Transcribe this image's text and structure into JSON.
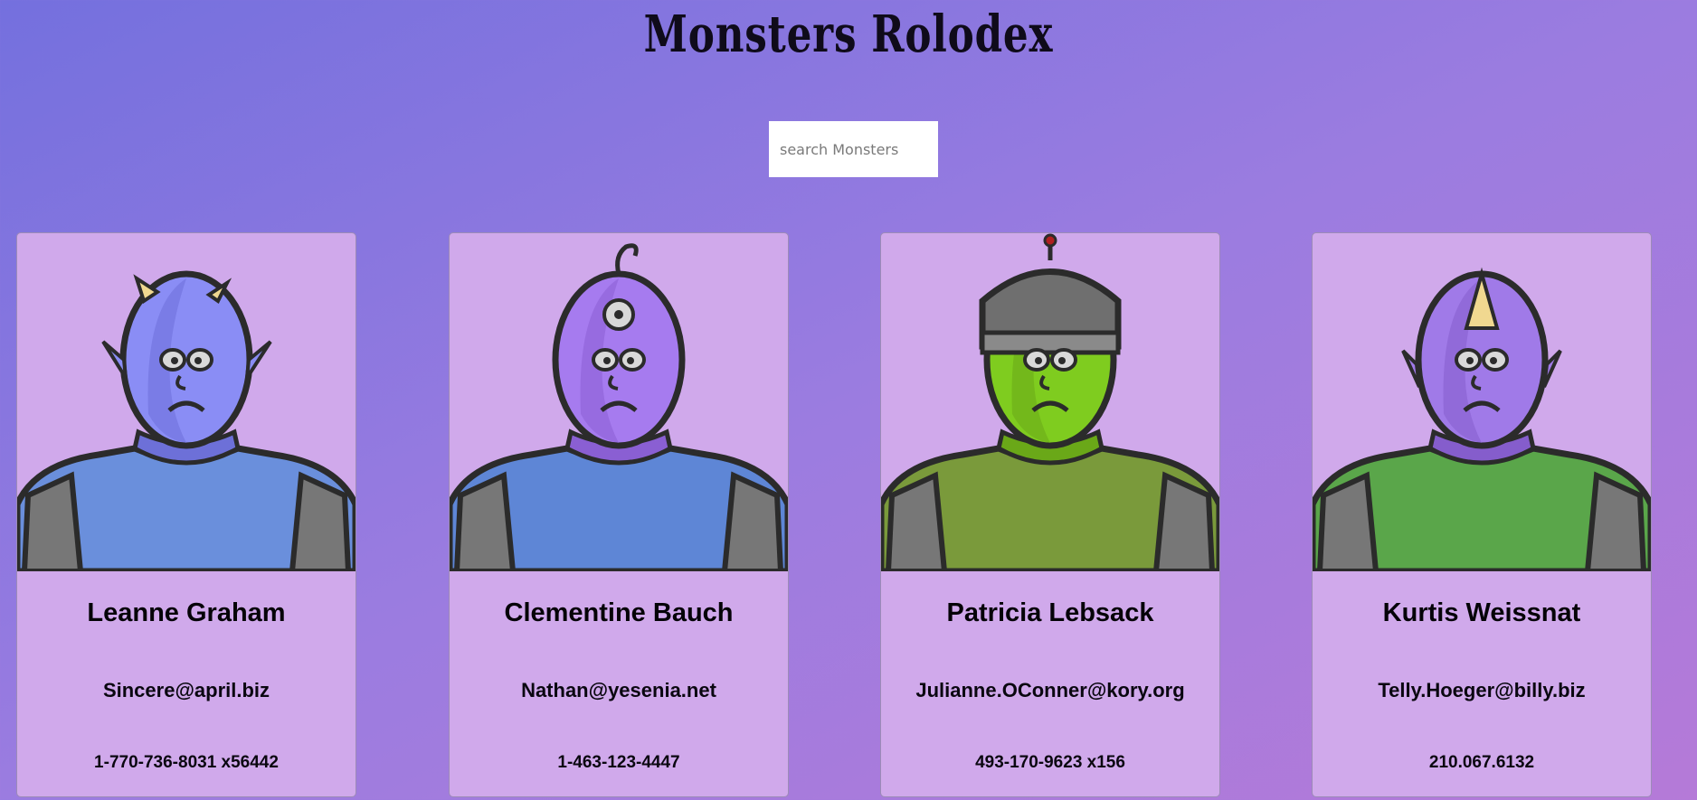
{
  "header": {
    "title": "Monsters Rolodex"
  },
  "search": {
    "placeholder": "search Monsters",
    "value": ""
  },
  "monsters": [
    {
      "name": "Leanne Graham",
      "email": "Sincere@april.biz",
      "phone": "1-770-736-8031 x56442",
      "skin": "#8a8df5",
      "skin_shade": "#6d70d8",
      "body": "#6a8fdc",
      "head_feature": "horns"
    },
    {
      "name": "Clementine Bauch",
      "email": "Nathan@yesenia.net",
      "phone": "1-463-123-4447",
      "skin": "#a67bef",
      "skin_shade": "#8a5fd3",
      "body": "#5e86d6",
      "head_feature": "third-eye"
    },
    {
      "name": "Patricia Lebsack",
      "email": "Julianne.OConner@kory.org",
      "phone": "493-170-9623 x156",
      "skin": "#7fcc1f",
      "skin_shade": "#6aa818",
      "body": "#7a9a3b",
      "head_feature": "helmet"
    },
    {
      "name": "Kurtis Weissnat",
      "email": "Telly.Hoeger@billy.biz",
      "phone": "210.067.6132",
      "skin": "#a07ae8",
      "skin_shade": "#855dcc",
      "body": "#5aa64a",
      "head_feature": "spike"
    }
  ]
}
